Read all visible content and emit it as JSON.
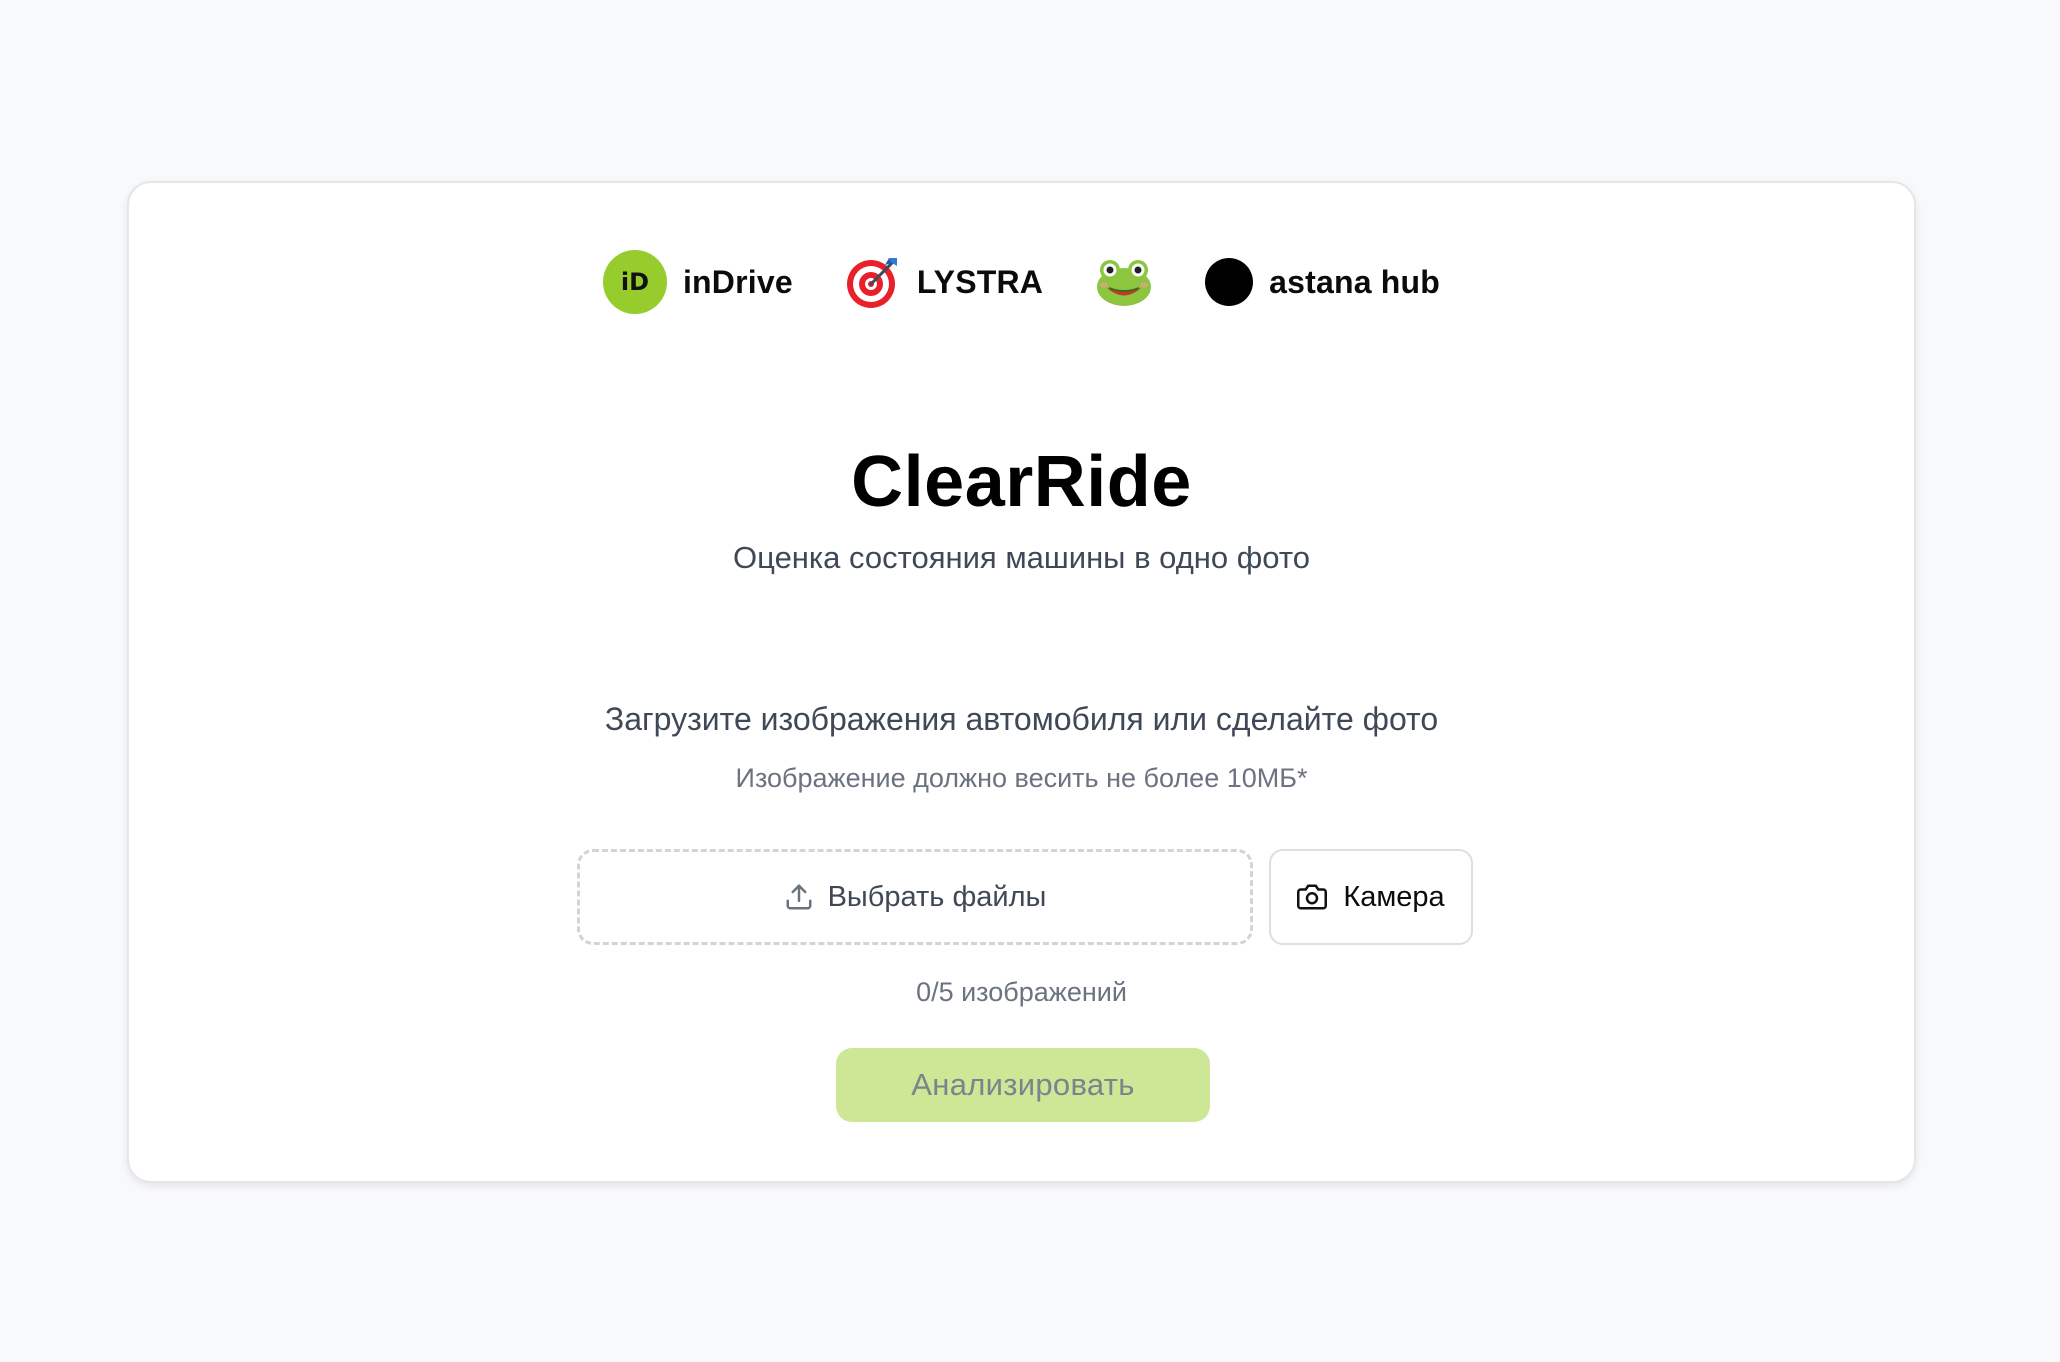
{
  "partners": [
    {
      "name": "inDrive",
      "logo_text": "iD",
      "icon": "indrive-logo-icon",
      "color": "#96cc2c"
    },
    {
      "name": "LYSTRA",
      "icon": "target-dart-icon"
    },
    {
      "name": "",
      "icon": "frog-icon"
    },
    {
      "name": "astana hub",
      "icon": "astana-hub-dot-icon",
      "color": "#000000"
    }
  ],
  "title": "ClearRide",
  "subtitle": "Оценка состояния машины в одно фото",
  "upload": {
    "heading": "Загрузите изображения автомобиля или сделайте фото",
    "note": "Изображение должно весить не более 10МБ*",
    "file_button_label": "Выбрать файлы",
    "file_button_icon": "upload-icon",
    "camera_button_label": "Камера",
    "camera_button_icon": "camera-icon",
    "counter": "0/5 изображений"
  },
  "analyze_button_label": "Анализировать",
  "colors": {
    "accent": "#96cc2c",
    "analyze_disabled_bg": "#cde797",
    "page_bg": "#f8f9fb"
  }
}
